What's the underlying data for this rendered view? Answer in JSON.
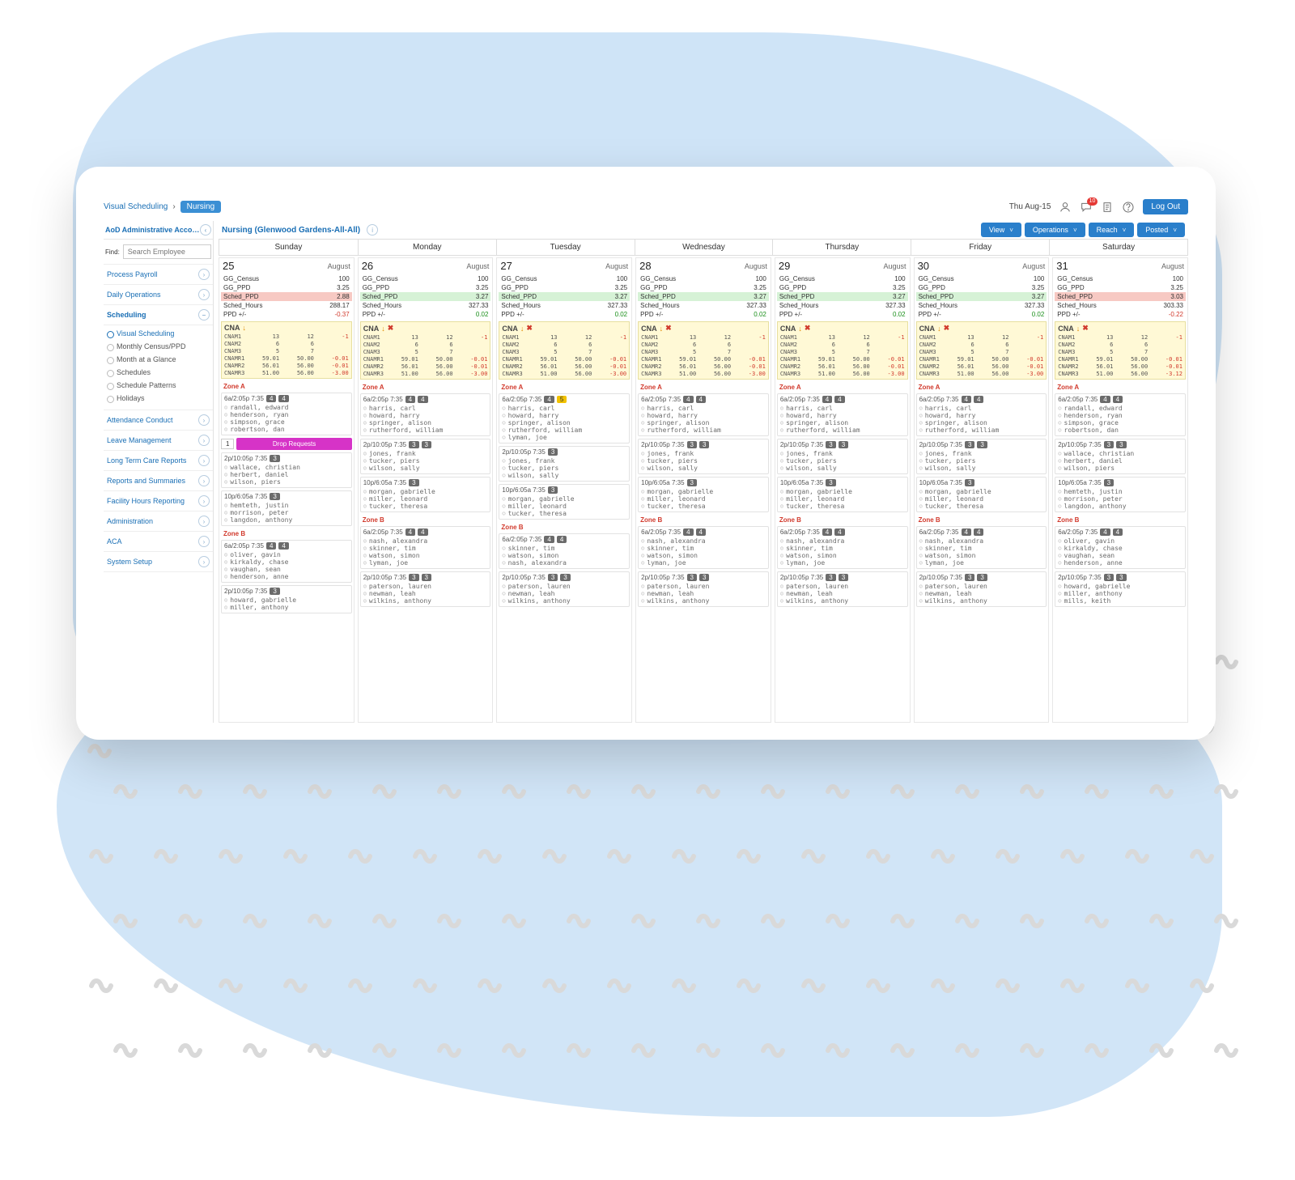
{
  "breadcrumb": {
    "root": "Visual Scheduling",
    "leaf": "Nursing"
  },
  "header": {
    "date": "Thu Aug-15",
    "notif_count": "10",
    "logout": "Log Out"
  },
  "icons": {
    "person": "person",
    "chat": "chat",
    "clipboard": "clipboard",
    "help": "help"
  },
  "sidebar": {
    "account": "AoD Administrative Acco…",
    "find_label": "Find:",
    "search_placeholder": "Search Employee",
    "sections": [
      {
        "label": "Process Payroll"
      },
      {
        "label": "Daily Operations"
      },
      {
        "label": "Scheduling",
        "open": true,
        "subs": [
          {
            "label": "Visual Scheduling",
            "active": true
          },
          {
            "label": "Monthly Census/PPD"
          },
          {
            "label": "Month at a Glance"
          },
          {
            "label": "Schedules"
          },
          {
            "label": "Schedule Patterns"
          },
          {
            "label": "Holidays"
          }
        ]
      },
      {
        "label": "Attendance Conduct",
        "sep": true
      },
      {
        "label": "Leave Management"
      },
      {
        "label": "Long Term Care Reports"
      },
      {
        "label": "Reports and Summaries"
      },
      {
        "label": "Facility Hours Reporting"
      },
      {
        "label": "Administration"
      },
      {
        "label": "ACA"
      },
      {
        "label": "System Setup"
      }
    ]
  },
  "main": {
    "title": "Nursing (Glenwood Gardens-All-All)",
    "buttons": [
      "View",
      "Operations",
      "Reach",
      "Posted"
    ]
  },
  "days": [
    "Sunday",
    "Monday",
    "Tuesday",
    "Wednesday",
    "Thursday",
    "Friday",
    "Saturday"
  ],
  "month": "August",
  "kpi_labels": [
    "GG_Census",
    "GG_PPD",
    "Sched_PPD",
    "Sched_Hours",
    "PPD +/-"
  ],
  "cna_label": "CNA",
  "matrix_rows": [
    "CNAM1",
    "CNAM2",
    "CNAM3",
    "CNAMR1",
    "CNAMR2",
    "CNAMR3"
  ],
  "zone_a": "Zone A",
  "zone_b": "Zone B",
  "drop_label": "Drop Requests",
  "columns": [
    {
      "date": "25",
      "kpis": [
        [
          "100",
          ""
        ],
        [
          "3.25",
          ""
        ],
        [
          "2.88",
          "r"
        ],
        [
          "288.17",
          ""
        ],
        [
          "-0.37",
          "neg"
        ]
      ],
      "cna_icons": [
        "↓"
      ],
      "matrix": [
        [
          "13",
          "12",
          "-1"
        ],
        [
          "6",
          "6",
          ""
        ],
        [
          "5",
          "7",
          ""
        ],
        [
          "59.01",
          "50.00",
          "-0.01"
        ],
        [
          "56.01",
          "56.00",
          "-0.01"
        ],
        [
          "51.00",
          "56.00",
          "-3.00"
        ]
      ],
      "zoneA": [
        {
          "hdr": "6a/2:05p 7:35",
          "badges": [
            "4",
            "4"
          ],
          "ppl": [
            "randall, edward",
            "henderson, ryan",
            "simpson, grace",
            "robertson, dan"
          ]
        },
        {
          "drop": true,
          "num": "1"
        },
        {
          "hdr": "2p/10:05p 7:35",
          "badges": [
            "3"
          ],
          "ppl": [
            "wallace, christian",
            "herbert, daniel",
            "wilson, piers"
          ]
        },
        {
          "hdr": "10p/6:05a 7:35",
          "badges": [
            "3"
          ],
          "ppl": [
            "hemteth, justin",
            "morrison, peter",
            "langdon, anthony"
          ]
        }
      ],
      "zoneB": [
        {
          "hdr": "6a/2:05p 7:35",
          "badges": [
            "4",
            "4"
          ],
          "ppl": [
            "oliver, gavin",
            "kirkaldy, chase",
            "vaughan, sean",
            "henderson, anne"
          ]
        },
        {
          "hdr": "2p/10:05p 7:35",
          "badges": [
            "3"
          ],
          "ppl": [
            "howard, gabrielle",
            "miller, anthony"
          ]
        }
      ]
    },
    {
      "date": "26",
      "kpis": [
        [
          "100",
          ""
        ],
        [
          "3.25",
          ""
        ],
        [
          "3.27",
          "g"
        ],
        [
          "327.33",
          ""
        ],
        [
          "0.02",
          "pos"
        ]
      ],
      "cna_icons": [
        "↓",
        "✖"
      ],
      "matrix": [
        [
          "13",
          "12",
          "-1"
        ],
        [
          "6",
          "6",
          ""
        ],
        [
          "5",
          "7",
          ""
        ],
        [
          "59.01",
          "50.00",
          "-0.01"
        ],
        [
          "56.01",
          "56.00",
          "-0.01"
        ],
        [
          "51.00",
          "56.00",
          "-3.00"
        ]
      ],
      "zoneA": [
        {
          "hdr": "6a/2:05p 7:35",
          "badges": [
            "4",
            "4"
          ],
          "ppl": [
            "harris, carl",
            "howard, harry",
            "springer, alison",
            "rutherford, william"
          ]
        },
        {
          "hdr": "2p/10:05p 7:35",
          "badges": [
            "3",
            "3"
          ],
          "ppl": [
            "jones, frank",
            "tucker, piers",
            "wilson, sally"
          ]
        },
        {
          "hdr": "10p/6:05a 7:35",
          "badges": [
            "3"
          ],
          "ppl": [
            "morgan, gabrielle",
            "miller, leonard",
            "tucker, theresa"
          ]
        }
      ],
      "zoneB": [
        {
          "hdr": "6a/2:05p 7:35",
          "badges": [
            "4",
            "4"
          ],
          "ppl": [
            "nash, alexandra",
            "skinner, tim",
            "watson, simon",
            "lyman, joe"
          ]
        },
        {
          "hdr": "2p/10:05p 7:35",
          "badges": [
            "3",
            "3"
          ],
          "ppl": [
            "paterson, lauren",
            "newman, leah",
            "wilkins, anthony"
          ]
        }
      ]
    },
    {
      "date": "27",
      "kpis": [
        [
          "100",
          ""
        ],
        [
          "3.25",
          ""
        ],
        [
          "3.27",
          "g"
        ],
        [
          "327.33",
          ""
        ],
        [
          "0.02",
          "pos"
        ]
      ],
      "cna_icons": [
        "↓",
        "✖"
      ],
      "matrix": [
        [
          "13",
          "12",
          "-1"
        ],
        [
          "6",
          "6",
          ""
        ],
        [
          "5",
          "7",
          ""
        ],
        [
          "59.01",
          "50.00",
          "-0.01"
        ],
        [
          "56.01",
          "56.00",
          "-0.01"
        ],
        [
          "51.00",
          "56.00",
          "-3.00"
        ]
      ],
      "zoneA": [
        {
          "hdr": "6a/2:05p 7:35",
          "badges": [
            "4",
            "5"
          ],
          "ybadge": true,
          "ppl": [
            "harris, carl",
            "howard, harry",
            "springer, alison",
            "rutherford, william",
            "lyman, joe"
          ]
        },
        {
          "hdr": "2p/10:05p 7:35",
          "badges": [
            "3"
          ],
          "ppl": [
            "jones, frank",
            "tucker, piers",
            "wilson, sally"
          ]
        },
        {
          "hdr": "10p/6:05a 7:35",
          "badges": [
            "3"
          ],
          "ppl": [
            "morgan, gabrielle",
            "miller, leonard",
            "tucker, theresa"
          ]
        }
      ],
      "zoneB": [
        {
          "hdr": "6a/2:05p 7:35",
          "badges": [
            "4",
            "4"
          ],
          "ppl": [
            "skinner, tim",
            "watson, simon",
            "nash, alexandra"
          ]
        },
        {
          "hdr": "2p/10:05p 7:35",
          "badges": [
            "3",
            "3"
          ],
          "ppl": [
            "paterson, lauren",
            "newman, leah",
            "wilkins, anthony"
          ]
        }
      ]
    },
    {
      "date": "28",
      "kpis": [
        [
          "100",
          ""
        ],
        [
          "3.25",
          ""
        ],
        [
          "3.27",
          "g"
        ],
        [
          "327.33",
          ""
        ],
        [
          "0.02",
          "pos"
        ]
      ],
      "cna_icons": [
        "↓",
        "✖"
      ],
      "matrix": [
        [
          "13",
          "12",
          "-1"
        ],
        [
          "6",
          "6",
          ""
        ],
        [
          "5",
          "7",
          ""
        ],
        [
          "59.01",
          "50.00",
          "-0.01"
        ],
        [
          "56.01",
          "56.00",
          "-0.01"
        ],
        [
          "51.00",
          "56.00",
          "-3.00"
        ]
      ],
      "zoneA": [
        {
          "hdr": "6a/2:05p 7:35",
          "badges": [
            "4",
            "4"
          ],
          "ppl": [
            "harris, carl",
            "howard, harry",
            "springer, alison",
            "rutherford, william"
          ]
        },
        {
          "hdr": "2p/10:05p 7:35",
          "badges": [
            "3",
            "3"
          ],
          "ppl": [
            "jones, frank",
            "tucker, piers",
            "wilson, sally"
          ]
        },
        {
          "hdr": "10p/6:05a 7:35",
          "badges": [
            "3"
          ],
          "ppl": [
            "morgan, gabrielle",
            "miller, leonard",
            "tucker, theresa"
          ]
        }
      ],
      "zoneB": [
        {
          "hdr": "6a/2:05p 7:35",
          "badges": [
            "4",
            "4"
          ],
          "ppl": [
            "nash, alexandra",
            "skinner, tim",
            "watson, simon",
            "lyman, joe"
          ]
        },
        {
          "hdr": "2p/10:05p 7:35",
          "badges": [
            "3",
            "3"
          ],
          "ppl": [
            "paterson, lauren",
            "newman, leah",
            "wilkins, anthony"
          ]
        }
      ]
    },
    {
      "date": "29",
      "kpis": [
        [
          "100",
          ""
        ],
        [
          "3.25",
          ""
        ],
        [
          "3.27",
          "g"
        ],
        [
          "327.33",
          ""
        ],
        [
          "0.02",
          "pos"
        ]
      ],
      "cna_icons": [
        "↓",
        "✖"
      ],
      "matrix": [
        [
          "13",
          "12",
          "-1"
        ],
        [
          "6",
          "6",
          ""
        ],
        [
          "5",
          "7",
          ""
        ],
        [
          "59.01",
          "50.00",
          "-0.01"
        ],
        [
          "56.01",
          "56.00",
          "-0.01"
        ],
        [
          "51.00",
          "56.00",
          "-3.00"
        ]
      ],
      "zoneA": [
        {
          "hdr": "6a/2:05p 7:35",
          "badges": [
            "4",
            "4"
          ],
          "ppl": [
            "harris, carl",
            "howard, harry",
            "springer, alison",
            "rutherford, william"
          ]
        },
        {
          "hdr": "2p/10:05p 7:35",
          "badges": [
            "3",
            "3"
          ],
          "ppl": [
            "jones, frank",
            "tucker, piers",
            "wilson, sally"
          ]
        },
        {
          "hdr": "10p/6:05a 7:35",
          "badges": [
            "3"
          ],
          "ppl": [
            "morgan, gabrielle",
            "miller, leonard",
            "tucker, theresa"
          ]
        }
      ],
      "zoneB": [
        {
          "hdr": "6a/2:05p 7:35",
          "badges": [
            "4",
            "4"
          ],
          "ppl": [
            "nash, alexandra",
            "skinner, tim",
            "watson, simon",
            "lyman, joe"
          ]
        },
        {
          "hdr": "2p/10:05p 7:35",
          "badges": [
            "3",
            "3"
          ],
          "ppl": [
            "paterson, lauren",
            "newman, leah",
            "wilkins, anthony"
          ]
        }
      ]
    },
    {
      "date": "30",
      "kpis": [
        [
          "100",
          ""
        ],
        [
          "3.25",
          ""
        ],
        [
          "3.27",
          "g"
        ],
        [
          "327.33",
          ""
        ],
        [
          "0.02",
          "pos"
        ]
      ],
      "cna_icons": [
        "↓",
        "✖"
      ],
      "matrix": [
        [
          "13",
          "12",
          "-1"
        ],
        [
          "6",
          "6",
          ""
        ],
        [
          "5",
          "7",
          ""
        ],
        [
          "59.01",
          "50.00",
          "-0.01"
        ],
        [
          "56.01",
          "56.00",
          "-0.01"
        ],
        [
          "51.00",
          "56.00",
          "-3.00"
        ]
      ],
      "zoneA": [
        {
          "hdr": "6a/2:05p 7:35",
          "badges": [
            "4",
            "4"
          ],
          "ppl": [
            "harris, carl",
            "howard, harry",
            "springer, alison",
            "rutherford, william"
          ]
        },
        {
          "hdr": "2p/10:05p 7:35",
          "badges": [
            "3",
            "3"
          ],
          "ppl": [
            "jones, frank",
            "tucker, piers",
            "wilson, sally"
          ]
        },
        {
          "hdr": "10p/6:05a 7:35",
          "badges": [
            "3"
          ],
          "ppl": [
            "morgan, gabrielle",
            "miller, leonard",
            "tucker, theresa"
          ]
        }
      ],
      "zoneB": [
        {
          "hdr": "6a/2:05p 7:35",
          "badges": [
            "4",
            "4"
          ],
          "ppl": [
            "nash, alexandra",
            "skinner, tim",
            "watson, simon",
            "lyman, joe"
          ]
        },
        {
          "hdr": "2p/10:05p 7:35",
          "badges": [
            "3",
            "3"
          ],
          "ppl": [
            "paterson, lauren",
            "newman, leah",
            "wilkins, anthony"
          ]
        }
      ]
    },
    {
      "date": "31",
      "kpis": [
        [
          "100",
          ""
        ],
        [
          "3.25",
          ""
        ],
        [
          "3.03",
          "r"
        ],
        [
          "303.33",
          ""
        ],
        [
          "-0.22",
          "neg"
        ]
      ],
      "cna_icons": [
        "↓",
        "✖"
      ],
      "matrix": [
        [
          "13",
          "12",
          "-1"
        ],
        [
          "6",
          "6",
          ""
        ],
        [
          "5",
          "7",
          ""
        ],
        [
          "59.01",
          "50.00",
          "-0.01"
        ],
        [
          "56.01",
          "56.00",
          "-0.01"
        ],
        [
          "51.00",
          "56.00",
          "-3.12"
        ]
      ],
      "zoneA": [
        {
          "hdr": "6a/2:05p 7:35",
          "badges": [
            "4",
            "4"
          ],
          "ppl": [
            "randall, edward",
            "henderson, ryan",
            "simpson, grace",
            "robertson, dan"
          ]
        },
        {
          "hdr": "2p/10:05p 7:35",
          "badges": [
            "3",
            "3"
          ],
          "ppl": [
            "wallace, christian",
            "herbert, daniel",
            "wilson, piers"
          ]
        },
        {
          "hdr": "10p/6:05a 7:35",
          "badges": [
            "3"
          ],
          "ppl": [
            "hemteth, justin",
            "morrison, peter",
            "langdon, anthony"
          ]
        }
      ],
      "zoneB": [
        {
          "hdr": "6a/2:05p 7:35",
          "badges": [
            "4",
            "4"
          ],
          "ppl": [
            "oliver, gavin",
            "kirkaldy, chase",
            "vaughan, sean",
            "henderson, anne"
          ]
        },
        {
          "hdr": "2p/10:05p 7:35",
          "badges": [
            "3",
            "3"
          ],
          "ppl": [
            "howard, gabrielle",
            "miller, anthony",
            "mills, keith"
          ]
        }
      ]
    }
  ]
}
